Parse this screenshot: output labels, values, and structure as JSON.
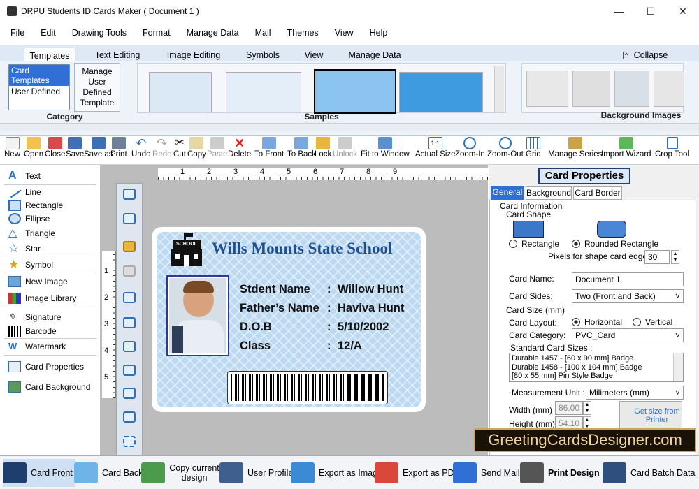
{
  "window": {
    "title": "DRPU Students ID Cards Maker ( Document 1 )"
  },
  "menu": [
    "File",
    "Edit",
    "Drawing Tools",
    "Format",
    "Manage Data",
    "Mail",
    "Themes",
    "View",
    "Help"
  ],
  "ribbon_tabs": [
    "Templates",
    "Text Editing",
    "Image Editing",
    "Symbols",
    "View",
    "Manage Data"
  ],
  "collapse_label": "Collapse",
  "category": {
    "items": [
      "Card Templates",
      "User Defined"
    ],
    "manage_label": "Manage User Defined Template",
    "group_label": "Category"
  },
  "samples_label": "Samples",
  "bg_images_label": "Background Images",
  "toolbar": [
    "New",
    "Open",
    "Close",
    "Save",
    "Save as",
    "Print",
    "Undo",
    "Redo",
    "Cut",
    "Copy",
    "Paste",
    "Delete",
    "To Front",
    "To Back",
    "Lock",
    "Unlock",
    "Fit to Window",
    "Actual Size",
    "Zoom-In",
    "Zoom-Out",
    "Grid",
    "Manage Series",
    "Import Wizard",
    "Crop Tool"
  ],
  "tools": [
    "Text",
    "Line",
    "Rectangle",
    "Ellipse",
    "Triangle",
    "Star",
    "Symbol",
    "New Image",
    "Image Library",
    "Signature",
    "Barcode",
    "Watermark",
    "Card Properties",
    "Card Background"
  ],
  "ruler": {
    "top": [
      "1",
      "2",
      "3",
      "4",
      "5",
      "6",
      "7",
      "8",
      "9"
    ],
    "left": [
      "1",
      "2",
      "3",
      "4",
      "5"
    ]
  },
  "card": {
    "school_name": "Wills Mounts State School",
    "school_sign": "SCHOOL",
    "fields": [
      {
        "label": "Stdent Name",
        "value": "Willow Hunt"
      },
      {
        "label": "Father’s Name",
        "value": "Haviva Hunt"
      },
      {
        "label": "D.O.B",
        "value": "5/10/2002"
      },
      {
        "label": "Class",
        "value": "12/A"
      }
    ]
  },
  "properties": {
    "title": "Card Properties",
    "tabs": [
      "General",
      "Background",
      "Card Border"
    ],
    "info_label": "Card Information",
    "shape_label": "Card Shape",
    "shape_rect": "Rectangle",
    "shape_rounded": "Rounded Rectangle",
    "pixels_label": "Pixels for shape card edge :",
    "pixels_value": "30",
    "name_label": "Card Name:",
    "name_value": "Document 1",
    "sides_label": "Card Sides:",
    "sides_value": "Two (Front and Back)",
    "size_label": "Card Size (mm)",
    "layout_label": "Card Layout:",
    "layout_h": "Horizontal",
    "layout_v": "Vertical",
    "category_label": "Card Category:",
    "category_value": "PVC_Card",
    "standard_label": "Standard Card Sizes :",
    "standard_items": [
      "Durable 1457 - [60 x 90 mm] Badge",
      "Durable 1458 - [100 x 104 mm] Badge",
      "[80 x 55 mm] Pin Style Badge"
    ],
    "unit_label": "Measurement Unit :",
    "unit_value": "Milimeters (mm)",
    "width_label": "Width  (mm)",
    "width_value": "86.00",
    "height_label": "Height  (mm)",
    "height_value": "54.10",
    "printer_btn": "Get size from Printer"
  },
  "watermark_text": "GreetingCardsDesigner.com",
  "bottom": [
    "Card Front",
    "Card Back",
    "Copy current design",
    "User Profile",
    "Export as Image",
    "Export as PDF",
    "Send Mail",
    "Print Design",
    "Card Batch Data"
  ]
}
